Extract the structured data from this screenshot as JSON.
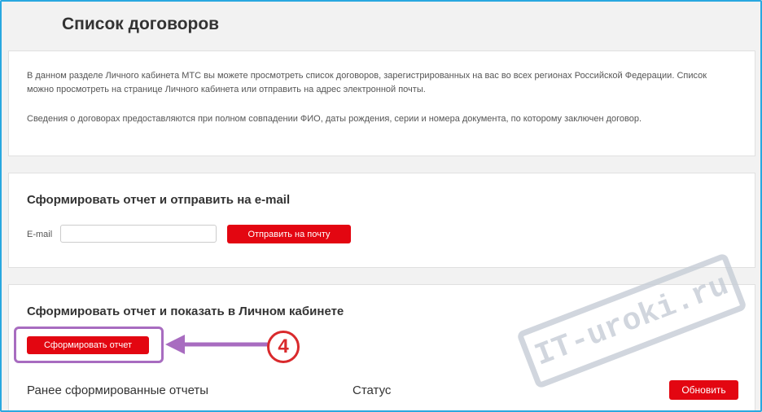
{
  "page": {
    "title": "Список договоров"
  },
  "info": {
    "paragraph1": "В данном разделе Личного кабинета МТС вы можете просмотреть список договоров, зарегистрированных на вас во всех регионах Российской Федерации. Список можно просмотреть на странице Личного кабинета или отправить на адрес электронной почты.",
    "paragraph2": "Сведения о договорах предоставляются при полном совпадении ФИО, даты рождения, серии и номера документа, по которому заключен договор."
  },
  "email_section": {
    "title": "Сформировать отчет и отправить на e-mail",
    "label": "E-mail",
    "input_value": "",
    "send_button": "Отправить на почту"
  },
  "report_section": {
    "title": "Сформировать отчет и показать в Личном кабинете",
    "generate_button": "Сформировать отчет",
    "step_number": "4",
    "col_previous": "Ранее сформированные отчеты",
    "col_status": "Статус",
    "refresh_button": "Обновить"
  },
  "watermark": {
    "text": "IT-uroki.ru"
  },
  "colors": {
    "accent_red": "#e30611",
    "frame_blue": "#29a8e0",
    "highlight_purple": "#a86cc0",
    "badge_red": "#d9292c"
  }
}
